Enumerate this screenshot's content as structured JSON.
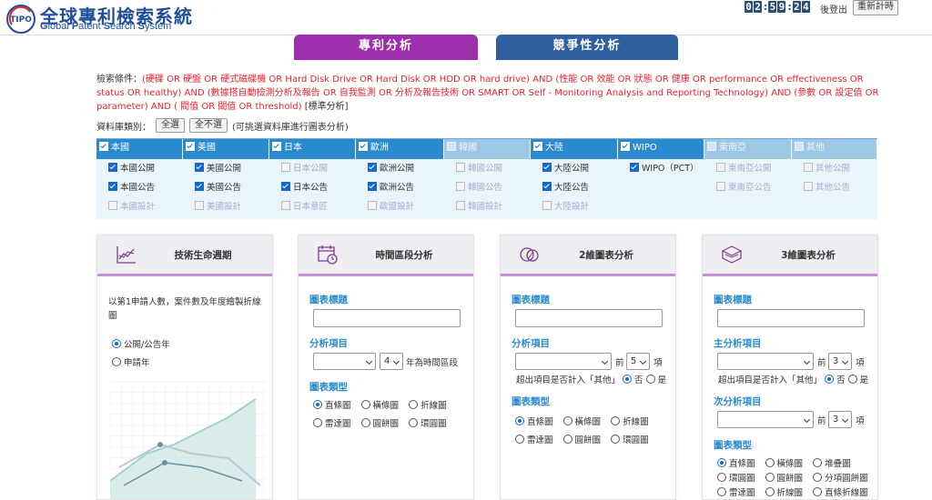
{
  "header": {
    "logo_text": "TIPO",
    "title": "全球專利檢索系統",
    "subtitle_parts": [
      "G",
      "lobal ",
      "P",
      "atent ",
      "S",
      "earch ",
      "S",
      "ystem"
    ],
    "timer": [
      "0",
      "2",
      ":",
      "5",
      "9",
      ":",
      "2",
      "4"
    ],
    "logout": "後登出",
    "reset": "重新計時"
  },
  "tabs": {
    "patent": "專利分析",
    "competitive": "競爭性分析"
  },
  "search": {
    "label": "檢索條件：",
    "query": "(硬碟 OR 硬盤 OR 硬式磁碟機 OR Hard Disk Drive OR Hard Disk OR HDD OR hard drive) AND (性能 OR 效能 OR 狀態 OR 健康 OR performance OR effectiveness OR status OR healthy) AND (數據搭自動檢測分析及報告 OR 自我監測 OR 分析及報告技術 OR SMART OR Self - Monitoring Analysis and Reporting Technology) AND (參數 OR 設定值 OR parameter) AND ( 閥值 OR 閾值 OR threshold)",
    "suffix": "[標準分析]"
  },
  "db": {
    "label": "資料庫類別：",
    "select_all": "全選",
    "select_none": "全不選",
    "hint": "(可挑選資料庫進行圖表分析)",
    "columns": [
      {
        "name": "本國",
        "on": true,
        "dis": false,
        "items": [
          {
            "label": "本國公開",
            "on": true,
            "dis": false
          },
          {
            "label": "本國公告",
            "on": true,
            "dis": false
          },
          {
            "label": "本國設計",
            "on": false,
            "dis": true
          }
        ]
      },
      {
        "name": "美國",
        "on": true,
        "dis": false,
        "items": [
          {
            "label": "美國公開",
            "on": true,
            "dis": false
          },
          {
            "label": "美國公告",
            "on": true,
            "dis": false
          },
          {
            "label": "美國設計",
            "on": false,
            "dis": true
          }
        ]
      },
      {
        "name": "日本",
        "on": true,
        "dis": false,
        "items": [
          {
            "label": "日本公開",
            "on": false,
            "dis": true
          },
          {
            "label": "日本公告",
            "on": true,
            "dis": false
          },
          {
            "label": "日本意匠",
            "on": false,
            "dis": true
          }
        ]
      },
      {
        "name": "歐洲",
        "on": true,
        "dis": false,
        "items": [
          {
            "label": "歐洲公開",
            "on": true,
            "dis": false
          },
          {
            "label": "歐洲公告",
            "on": true,
            "dis": false
          },
          {
            "label": "歐盟設計",
            "on": false,
            "dis": true
          }
        ]
      },
      {
        "name": "韓國",
        "on": false,
        "dis": true,
        "items": [
          {
            "label": "韓國公開",
            "on": false,
            "dis": true
          },
          {
            "label": "韓國公告",
            "on": false,
            "dis": true
          },
          {
            "label": "韓國設計",
            "on": false,
            "dis": true
          }
        ]
      },
      {
        "name": "大陸",
        "on": true,
        "dis": false,
        "items": [
          {
            "label": "大陸公開",
            "on": true,
            "dis": false
          },
          {
            "label": "大陸公告",
            "on": true,
            "dis": false
          },
          {
            "label": "大陸設計",
            "on": false,
            "dis": true
          }
        ]
      },
      {
        "name": "WIPO",
        "on": true,
        "dis": false,
        "items": [
          {
            "label": "WIPO（PCT）",
            "on": true,
            "dis": false
          }
        ]
      },
      {
        "name": "東南亞",
        "on": false,
        "dis": true,
        "items": [
          {
            "label": "東南亞公開",
            "on": false,
            "dis": true
          },
          {
            "label": "東南亞公告",
            "on": false,
            "dis": true
          }
        ]
      },
      {
        "name": "其他",
        "on": false,
        "dis": true,
        "items": [
          {
            "label": "其他公開",
            "on": false,
            "dis": true
          },
          {
            "label": "其他公告",
            "on": false,
            "dis": true
          }
        ]
      }
    ]
  },
  "cards": {
    "lifecycle": {
      "title": "技術生命週期",
      "desc": "以第1申請人數，案件數及年度繪製折線圖",
      "options": [
        "公開/公告年",
        "申請年"
      ]
    },
    "period": {
      "title": "時間區段分析",
      "chart_title_label": "圖表標題",
      "item_label": "分析項目",
      "period_value": "4",
      "period_suffix": "年為時間區段",
      "type_label": "圖表類型",
      "types": [
        "直條圖",
        "橫條圖",
        "折線圖",
        "雷達圖",
        "圓餅圖",
        "環圓圖"
      ]
    },
    "chart2d": {
      "title": "2維圖表分析",
      "chart_title_label": "圖表標題",
      "item_label": "分析項目",
      "top_prefix": "前",
      "top_value": "5",
      "top_suffix": "項",
      "other_q": "超出項目是否計入「其他」",
      "no": "否",
      "yes": "是",
      "type_label": "圖表類型",
      "types": [
        "直條圖",
        "橫條圖",
        "折線圖",
        "雷達圖",
        "圓餅圖",
        "環圓圖"
      ]
    },
    "chart3d": {
      "title": "3維圖表分析",
      "chart_title_label": "圖表標題",
      "main_label": "主分析項目",
      "top_prefix": "前",
      "top_value": "3",
      "top_suffix": "項",
      "other_q": "超出項目是否計入「其他」",
      "no": "否",
      "yes": "是",
      "sub_label": "次分析項目",
      "sub_top_value": "3",
      "type_label": "圖表類型",
      "types": [
        "直條圖",
        "橫條圖",
        "堆疊圖",
        "環圓圖",
        "圓餅圖",
        "分項圓餅圖",
        "雷達圖",
        "折線圖",
        "直條折線圖"
      ]
    }
  }
}
